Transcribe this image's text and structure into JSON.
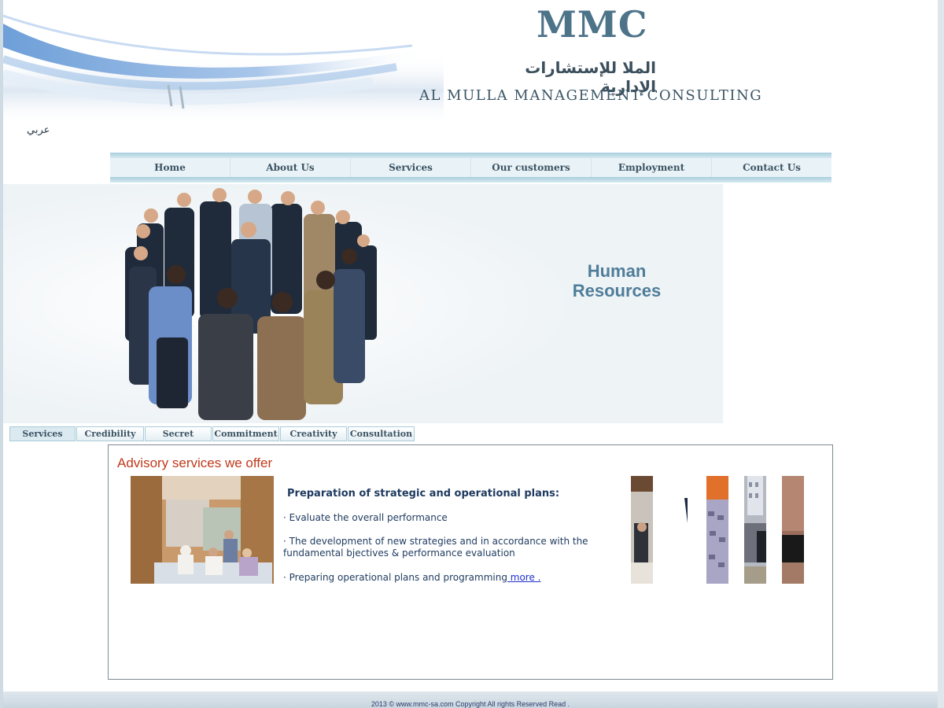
{
  "header": {
    "logo": "MMC",
    "arabic_name": "الملا للإستشارات الإدارية",
    "english_name": "AL MULLA MANAGEMENT CONSULTING",
    "language_link": "عربي"
  },
  "nav": {
    "items": [
      {
        "label": "Home"
      },
      {
        "label": "About Us"
      },
      {
        "label": "Services"
      },
      {
        "label": "Our customers"
      },
      {
        "label": "Employment"
      },
      {
        "label": "Contact Us"
      }
    ]
  },
  "banner": {
    "line1": "Human",
    "line2": "Resources"
  },
  "tabs": [
    {
      "label": "Services"
    },
    {
      "label": "Credibility"
    },
    {
      "label": "Secret"
    },
    {
      "label": "Commitment"
    },
    {
      "label": "Creativity"
    },
    {
      "label": "Consultation"
    }
  ],
  "content": {
    "title": "Advisory services we offer",
    "heading": "Preparation of strategic and operational plans:",
    "bullets": [
      "· Evaluate the overall performance",
      "· The development of new strategies and in accordance with the",
      "fundamental bjectives & performance evaluation",
      "· Preparing operational plans and programming"
    ],
    "more_link": " more ."
  },
  "footer": {
    "copyright": "2013 © www.mmc-sa.com Copyright  All rights Reserved Read ."
  }
}
